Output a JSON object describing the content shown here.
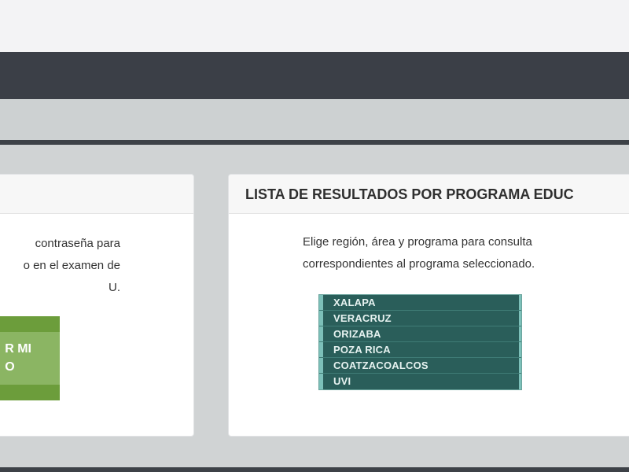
{
  "left_card": {
    "text_lines": [
      "contraseña para",
      "o en el examen de",
      "U."
    ],
    "button_lines": [
      "R MI",
      "O"
    ]
  },
  "right_card": {
    "title": "LISTA DE RESULTADOS POR PROGRAMA EDUC",
    "description_lines": [
      "Elige región, área y programa para consulta",
      "correspondientes al programa seleccionado."
    ],
    "regions": [
      {
        "label": "XALAPA"
      },
      {
        "label": "VERACRUZ"
      },
      {
        "label": "ORIZABA"
      },
      {
        "label": "POZA RICA"
      },
      {
        "label": "COATZACOALCOS"
      },
      {
        "label": "UVI"
      }
    ]
  },
  "colors": {
    "dark_band": "#3b3f47",
    "region_bg": "#2a5e5a",
    "green_button": "#6c9d3b"
  }
}
